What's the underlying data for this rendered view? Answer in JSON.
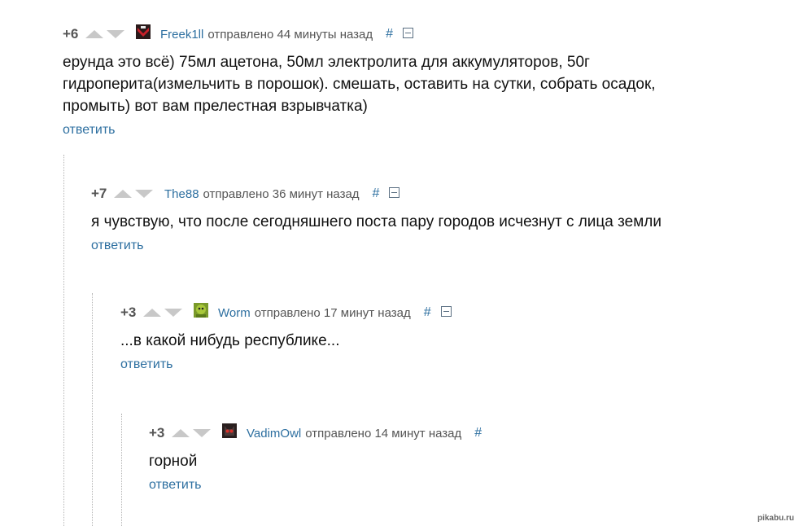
{
  "comments": [
    {
      "rating": "+6",
      "author": "Freek1ll",
      "time": "отправлено 44 минуты назад",
      "hash": "#",
      "text": "ерунда это всё) 75мл ацетона, 50мл электролита для аккумуляторов, 50г гидроперита(измельчить в порошок). смешать, оставить на сутки, собрать осадок, промыть) вот вам прелестная взрывчатка)",
      "reply": "ответить",
      "avatar": "avatar-red-black"
    },
    {
      "rating": "+7",
      "author": "The88",
      "time": "отправлено 36 минут назад",
      "hash": "#",
      "text": "я чувствую, что после сегодняшнего поста пару городов исчезнут с лица земли",
      "reply": "ответить"
    },
    {
      "rating": "+3",
      "author": "Worm",
      "time": "отправлено 17 минут назад",
      "hash": "#",
      "text": "...в какой нибудь республике...",
      "reply": "ответить",
      "avatar": "avatar-green"
    },
    {
      "rating": "+3",
      "author": "VadimOwl",
      "time": "отправлено 14 минут назад",
      "hash": "#",
      "text": "горной",
      "reply": "ответить",
      "avatar": "avatar-dark-owl"
    }
  ],
  "watermark": "pikabu.ru",
  "colors": {
    "link": "#2d6fa0",
    "arrow": "#c8c8c8",
    "text": "#111111"
  }
}
